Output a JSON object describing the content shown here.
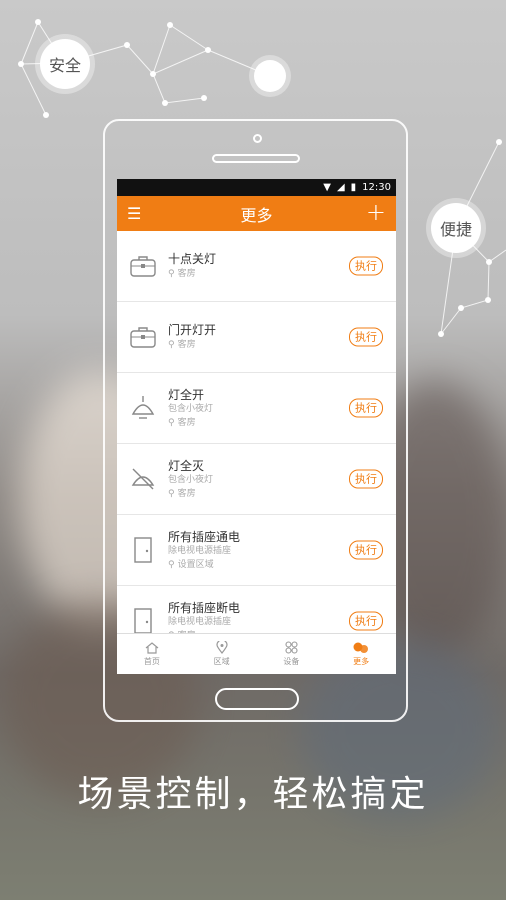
{
  "bubbles": {
    "left": "安全",
    "right": "便捷"
  },
  "status": {
    "time": "12:30"
  },
  "appbar": {
    "menu_icon": "☰",
    "title": "更多",
    "add_icon": "+"
  },
  "scenes": [
    {
      "title": "十点关灯",
      "subtitle": "",
      "location": "客房",
      "icon": "briefcase-icon",
      "action": "执行"
    },
    {
      "title": "门开灯开",
      "subtitle": "",
      "location": "客房",
      "icon": "briefcase-icon",
      "action": "执行"
    },
    {
      "title": "灯全开",
      "subtitle": "包含小夜灯",
      "location": "客房",
      "icon": "lamp-icon",
      "action": "执行"
    },
    {
      "title": "灯全灭",
      "subtitle": "包含小夜灯",
      "location": "客房",
      "icon": "lamp-off-icon",
      "action": "执行"
    },
    {
      "title": "所有插座通电",
      "subtitle": "除电视电源插座",
      "location": "设置区域",
      "icon": "door-icon",
      "action": "执行"
    },
    {
      "title": "所有插座断电",
      "subtitle": "除电视电源插座",
      "location": "客房",
      "icon": "door-icon",
      "action": "执行"
    }
  ],
  "tabs": [
    {
      "label": "首页",
      "icon": "home-icon"
    },
    {
      "label": "区域",
      "icon": "location-icon"
    },
    {
      "label": "设备",
      "icon": "devices-icon"
    },
    {
      "label": "更多",
      "icon": "more-icon",
      "active": true
    }
  ],
  "caption": "场景控制，轻松搞定",
  "colors": {
    "accent": "#f07d14"
  }
}
